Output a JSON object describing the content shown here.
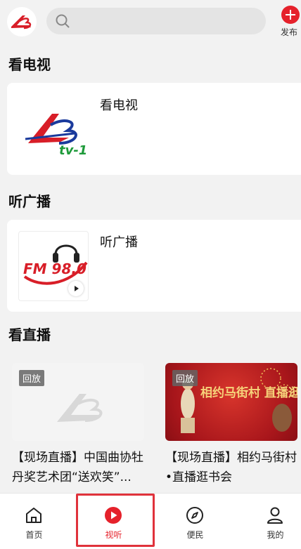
{
  "header": {
    "search_placeholder": "",
    "publish_label": "发布"
  },
  "sections": {
    "tv": {
      "title": "看电视",
      "card_name": "看电视",
      "logo_text": "tv-1"
    },
    "radio": {
      "title": "听广播",
      "card_name": "听广播",
      "logo_text": "FM 98.0"
    },
    "live": {
      "title": "看直播",
      "items": [
        {
          "badge": "回放",
          "title": "【现场直播】中国曲协牡丹奖艺术团“送欢笑”..."
        },
        {
          "badge": "回放",
          "title": "【现场直播】相约马街村•直播逛书会",
          "poster_text": "相约马街村 直播逛书会"
        }
      ]
    }
  },
  "bottom_nav": {
    "items": [
      {
        "label": "首页",
        "icon": "home-icon"
      },
      {
        "label": "视听",
        "icon": "play-circle-icon",
        "active": true
      },
      {
        "label": "便民",
        "icon": "compass-icon"
      },
      {
        "label": "我的",
        "icon": "user-icon"
      }
    ]
  },
  "colors": {
    "accent": "#e5212b",
    "background": "#f2f2f2"
  }
}
